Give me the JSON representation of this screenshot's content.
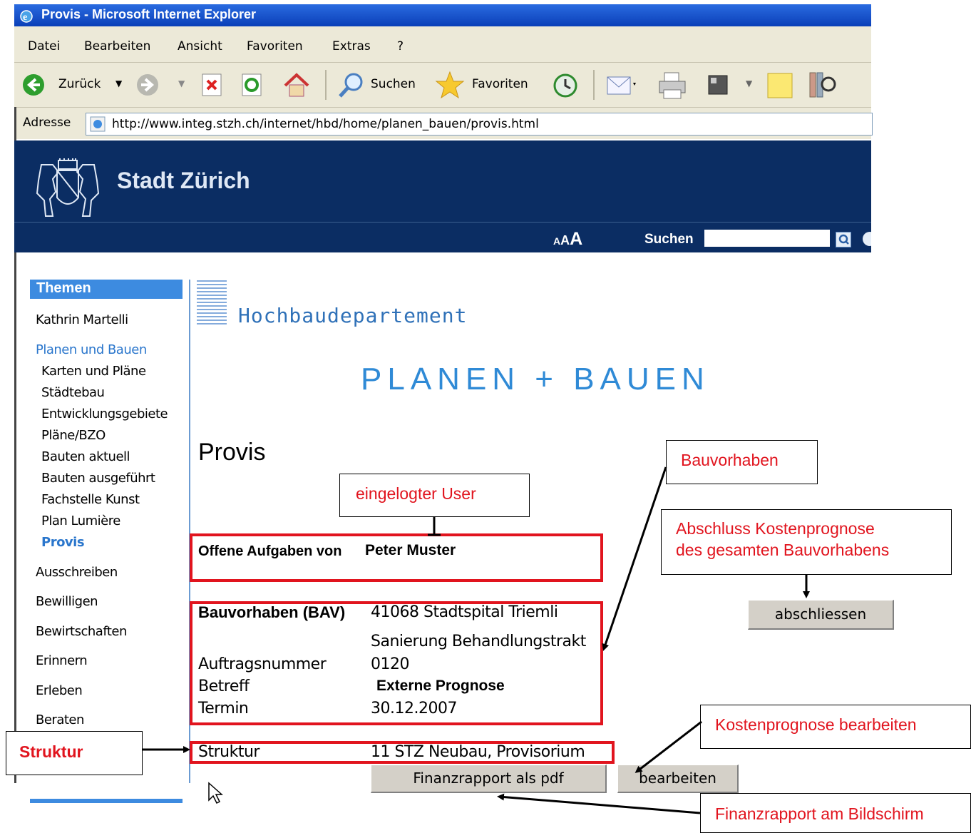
{
  "window": {
    "title": "Provis - Microsoft Internet Explorer"
  },
  "menu": [
    "Datei",
    "Bearbeiten",
    "Ansicht",
    "Favoriten",
    "Extras",
    "?"
  ],
  "toolbar": {
    "back": "Zurück",
    "search": "Suchen",
    "favorites": "Favoriten"
  },
  "address": {
    "label": "Adresse",
    "url": "http://www.integ.stzh.ch/internet/hbd/home/planen_bauen/provis.html"
  },
  "header": {
    "title": "Stadt Zürich",
    "font_small": "A",
    "font_medium": "A",
    "font_large": "A",
    "search_label": "Suchen",
    "search_value": ""
  },
  "sidebar": {
    "heading": "Themen",
    "items": [
      "Kathrin Martelli",
      "Planen und Bauen",
      "Karten und Pläne",
      "Städtebau",
      "Entwicklungsgebiete",
      "Pläne/BZO",
      "Bauten aktuell",
      "Bauten ausgeführt",
      "Fachstelle Kunst",
      "Plan Lumière",
      "Provis",
      "Ausschreiben",
      "Bewilligen",
      "Bewirtschaften",
      "Erinnern",
      "Erleben",
      "Beraten"
    ]
  },
  "content": {
    "department": "Hochbaudepartement",
    "banner": "PLANEN + BAUEN",
    "heading": "Provis",
    "tasks_label": "Offene Aufgaben von",
    "user_name": "Peter Muster",
    "bav_label": "Bauvorhaben (BAV)",
    "bav_value": "41068 Stadtspital Triemli",
    "bav_value2": "Sanierung Behandlungstrakt",
    "order_label": "Auftragsnummer",
    "order_value": "0120",
    "subject_label": "Betreff",
    "subject_value": "Externe Prognose",
    "date_label": "Termin",
    "date_value": "30.12.2007",
    "structure_label": "Struktur",
    "structure_value": "11 STZ Neubau, Provisorium",
    "btn_pdf": "Finanzrapport als pdf",
    "btn_edit": "bearbeiten",
    "btn_close": "abschliessen"
  },
  "annotations": {
    "user": "eingelogter User",
    "project": "Bauvorhaben",
    "close_l1": "Abschluss Kostenprognose",
    "close_l2": "des gesamten Bauvorhabens",
    "edit": "Kostenprognose bearbeiten",
    "structure": "Struktur",
    "report": "Finanzrapport am Bildschirm"
  },
  "colors": {
    "header_bg": "#0b2d63",
    "accent_blue": "#3d8be0",
    "annotation_red": "#e1141e"
  }
}
